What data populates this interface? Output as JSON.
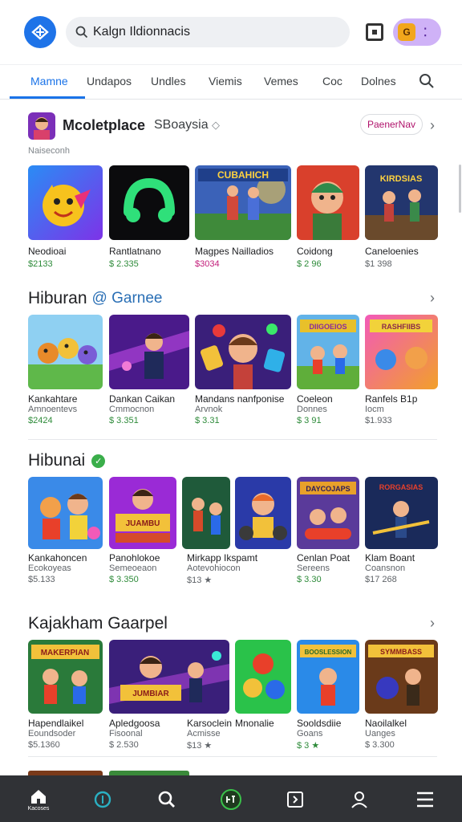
{
  "search": {
    "value": "Kalgn Ildionnacis"
  },
  "top": {
    "pill_badge": "G"
  },
  "tabs": [
    {
      "label": "Mamne"
    },
    {
      "label": "Undapos"
    },
    {
      "label": "Undles"
    },
    {
      "label": "Viemis"
    },
    {
      "label": "Vemes"
    },
    {
      "label": "Coc"
    },
    {
      "label": "Dolnes"
    }
  ],
  "marketplace": {
    "title": "Mcoletplace",
    "subtitle": "SBoaysia",
    "chip": "PaenerNav",
    "caption": "Naiseconh",
    "items": [
      {
        "name": "Neodioai",
        "price": "$2133",
        "price_color": "green"
      },
      {
        "name": "Rantlatnano",
        "price": "$ 2.335",
        "price_color": "green"
      },
      {
        "name": "Magpes Nailladios",
        "price": "$3034",
        "price_color": "pink"
      },
      {
        "name": "Coidong",
        "price": "$ 2 96",
        "price_color": "green"
      },
      {
        "name": "Caneloenies",
        "price": "$1 398",
        "price_color": "gray"
      }
    ]
  },
  "hiburan_games": {
    "title": "Hiburan",
    "subtitle": "@ Garnee",
    "items": [
      {
        "name": "Kankahtare",
        "sub": "Amnoentevs",
        "price": "$2424",
        "price_color": "green"
      },
      {
        "name": "Dankan Caikan",
        "sub": "Cmmocnon",
        "price": "$ 3.351",
        "price_color": "green"
      },
      {
        "name": "Mandans nanfponise",
        "sub": "Arvnok",
        "price": "$ 3.31",
        "price_color": "green"
      },
      {
        "name": "Coeleon",
        "sub": "Donnes",
        "price": "$ 3 91",
        "price_color": "green"
      },
      {
        "name": "Ranfels B1p",
        "sub": "Iocm",
        "price": "$1.933",
        "price_color": "gray"
      }
    ]
  },
  "hiburan": {
    "title": "Hibunai",
    "items": [
      {
        "name": "Kankahoncen",
        "sub": "Ecokoyeas",
        "price": "$5.133",
        "price_color": "gray"
      },
      {
        "name": "Panohlokoe",
        "sub": "Semeoeaon",
        "price": "$ 3.350",
        "price_color": "green"
      },
      {
        "name": "Mirkapp Ikspamt",
        "sub": "Aotevohiocon",
        "price": "$13 ★",
        "price_color": "gray"
      },
      {
        "name": "Cenlan Poat",
        "sub": "Sereens",
        "price": "$ 3.30",
        "price_color": "green"
      },
      {
        "name": "Klam Boant",
        "sub": "Coansnon",
        "price": "$17 268",
        "price_color": "gray"
      }
    ]
  },
  "kajakham": {
    "title": "Kajakham Gaarpel",
    "items": [
      {
        "name": "Hapendlaikel",
        "sub": "Eoundsoder",
        "price": "$5.1360",
        "price_color": "gray"
      },
      {
        "name": "Apledgoosa",
        "sub": "Fisoonal",
        "price": "$ 2.530",
        "price_color": "gray"
      },
      {
        "name": "Karsoclein",
        "sub": "Acmisse",
        "price": "$13 ★",
        "price_color": "gray"
      },
      {
        "name": "Mnonalie",
        "sub": "",
        "price": "",
        "price_color": "gray"
      },
      {
        "name": "Sooldsdiie",
        "sub": "Goans",
        "price": "$ 3 ★",
        "price_color": "green"
      },
      {
        "name": "Naoilalkel",
        "sub": "Uanges",
        "price": "$ 3.300",
        "price_color": "gray"
      }
    ]
  },
  "bottom_nav": {
    "home_label": "Kacoses"
  },
  "colors": {
    "accent": "#1a73e8",
    "nav_bg": "#303236",
    "price_green": "#2e8b3a",
    "price_pink": "#c21d7a"
  }
}
